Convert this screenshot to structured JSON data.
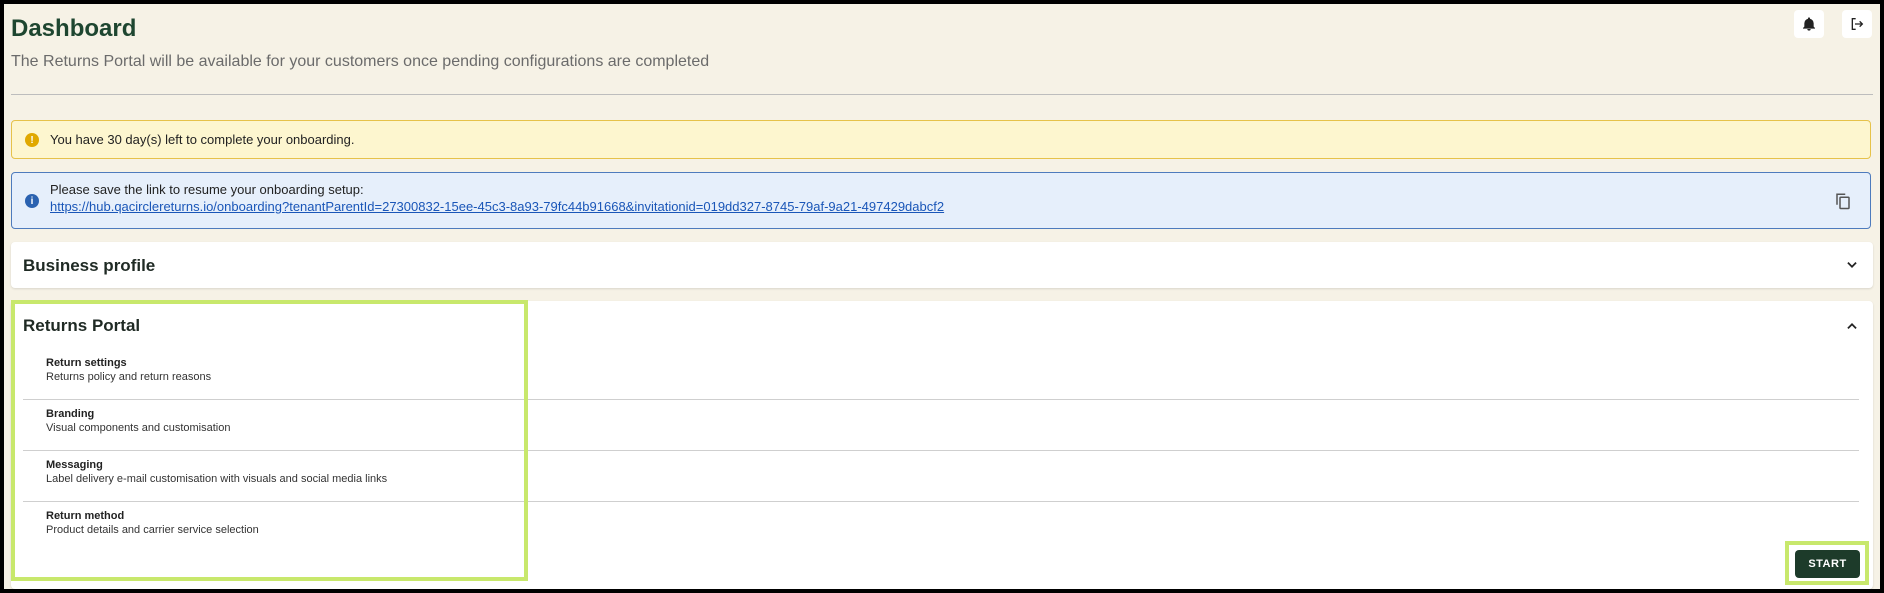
{
  "header": {
    "title": "Dashboard",
    "subtitle": "The Returns Portal will be available for your customers once pending configurations are completed",
    "icons": [
      "bell-icon",
      "logout-icon"
    ]
  },
  "alerts": {
    "warning": {
      "icon": "exclamation-icon",
      "text": "You have 30 day(s) left to complete your onboarding."
    },
    "info": {
      "icon": "info-icon",
      "text": "Please save the link to resume your onboarding setup:",
      "link": "https://hub.qacirclereturns.io/onboarding?tenantParentId=27300832-15ee-45c3-8a93-79fc44b91668&invitationid=019dd327-8745-79af-9a21-497429dabcf2",
      "copy_icon": "copy-icon"
    }
  },
  "sections": {
    "business_profile": {
      "title": "Business profile",
      "icon": "chevron-down-icon"
    },
    "returns_portal": {
      "title": "Returns Portal",
      "icon": "chevron-up-icon",
      "steps": [
        {
          "title": "Return settings",
          "description": "Returns policy and return reasons"
        },
        {
          "title": "Branding",
          "description": "Visual components and customisation"
        },
        {
          "title": "Messaging",
          "description": "Label delivery e-mail customisation with visuals and social media links"
        },
        {
          "title": "Return method",
          "description": "Product details and carrier service selection"
        }
      ],
      "start_label": "START"
    }
  },
  "colors": {
    "page_background": "#f6f2e6",
    "title_green": "#1e4630",
    "primary_button": "#1d3b2a",
    "warning_bg": "#fdf6cf",
    "info_bg": "#e6effb",
    "highlight": "#c8e86c"
  }
}
